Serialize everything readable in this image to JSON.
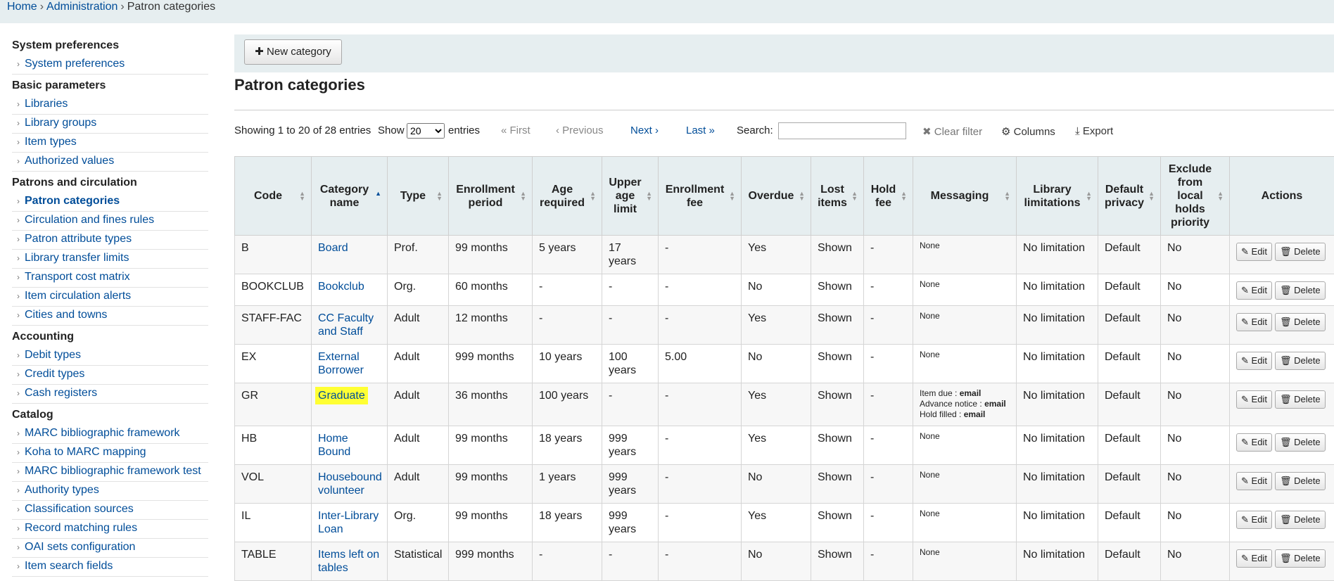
{
  "breadcrumb": {
    "home": "Home",
    "sep": "›",
    "admin": "Administration",
    "current": "Patron categories"
  },
  "sidebar": {
    "sections": [
      {
        "title": "System preferences",
        "items": [
          {
            "label": "System preferences"
          }
        ]
      },
      {
        "title": "Basic parameters",
        "items": [
          {
            "label": "Libraries"
          },
          {
            "label": "Library groups"
          },
          {
            "label": "Item types"
          },
          {
            "label": "Authorized values"
          }
        ]
      },
      {
        "title": "Patrons and circulation",
        "items": [
          {
            "label": "Patron categories",
            "active": true
          },
          {
            "label": "Circulation and fines rules"
          },
          {
            "label": "Patron attribute types"
          },
          {
            "label": "Library transfer limits"
          },
          {
            "label": "Transport cost matrix"
          },
          {
            "label": "Item circulation alerts"
          },
          {
            "label": "Cities and towns"
          }
        ]
      },
      {
        "title": "Accounting",
        "items": [
          {
            "label": "Debit types"
          },
          {
            "label": "Credit types"
          },
          {
            "label": "Cash registers"
          }
        ]
      },
      {
        "title": "Catalog",
        "items": [
          {
            "label": "MARC bibliographic framework"
          },
          {
            "label": "Koha to MARC mapping"
          },
          {
            "label": "MARC bibliographic framework test"
          },
          {
            "label": "Authority types"
          },
          {
            "label": "Classification sources"
          },
          {
            "label": "Record matching rules"
          },
          {
            "label": "OAI sets configuration"
          },
          {
            "label": "Item search fields"
          }
        ]
      }
    ]
  },
  "toolbar": {
    "new_category": "New category"
  },
  "page_title": "Patron categories",
  "controls": {
    "showing": "Showing 1 to 20 of 28 entries",
    "show": "Show",
    "page_length": "20",
    "entries": "entries",
    "first": "« First",
    "previous": "‹ Previous",
    "next": "Next ›",
    "last": "Last »",
    "search": "Search:",
    "search_value": "",
    "clear_filter": "Clear filter",
    "columns": "Columns",
    "export": "Export"
  },
  "table": {
    "headers": [
      "Code",
      "Category name",
      "Type",
      "Enrollment period",
      "Age required",
      "Upper age limit",
      "Enrollment fee",
      "Overdue",
      "Lost items",
      "Hold fee",
      "Messaging",
      "Library limitations",
      "Default privacy",
      "Exclude from local holds priority",
      "Actions"
    ],
    "edit": "Edit",
    "delete": "Delete",
    "rows": [
      {
        "code": "B",
        "name": "Board",
        "type": "Prof.",
        "enroll": "99 months",
        "age": "5 years",
        "upper": "17 years",
        "fee": "-",
        "overdue": "Yes",
        "lost": "Shown",
        "hold": "-",
        "messaging": [
          "None"
        ],
        "limit": "No limitation",
        "privacy": "Default",
        "exclude": "No"
      },
      {
        "code": "BOOKCLUB",
        "name": "Bookclub",
        "type": "Org.",
        "enroll": "60 months",
        "age": "-",
        "upper": "-",
        "fee": "-",
        "overdue": "No",
        "lost": "Shown",
        "hold": "-",
        "messaging": [
          "None"
        ],
        "limit": "No limitation",
        "privacy": "Default",
        "exclude": "No"
      },
      {
        "code": "STAFF-FAC",
        "name": "CC Faculty and Staff",
        "type": "Adult",
        "enroll": "12 months",
        "age": "-",
        "upper": "-",
        "fee": "-",
        "overdue": "Yes",
        "lost": "Shown",
        "hold": "-",
        "messaging": [
          "None"
        ],
        "limit": "No limitation",
        "privacy": "Default",
        "exclude": "No"
      },
      {
        "code": "EX",
        "name": "External Borrower",
        "type": "Adult",
        "enroll": "999 months",
        "age": "10 years",
        "upper": "100 years",
        "fee": "5.00",
        "overdue": "No",
        "lost": "Shown",
        "hold": "-",
        "messaging": [
          "None"
        ],
        "limit": "No limitation",
        "privacy": "Default",
        "exclude": "No"
      },
      {
        "code": "GR",
        "name": "Graduate",
        "highlight": true,
        "type": "Adult",
        "enroll": "36 months",
        "age": "100 years",
        "upper": "-",
        "fee": "-",
        "overdue": "Yes",
        "lost": "Shown",
        "hold": "-",
        "messaging": [
          {
            "k": "Item due : ",
            "v": "email"
          },
          {
            "k": "Advance notice : ",
            "v": "email"
          },
          {
            "k": "Hold filled : ",
            "v": "email"
          }
        ],
        "limit": "No limitation",
        "privacy": "Default",
        "exclude": "No"
      },
      {
        "code": "HB",
        "name": "Home Bound",
        "type": "Adult",
        "enroll": "99 months",
        "age": "18 years",
        "upper": "999 years",
        "fee": "-",
        "overdue": "Yes",
        "lost": "Shown",
        "hold": "-",
        "messaging": [
          "None"
        ],
        "limit": "No limitation",
        "privacy": "Default",
        "exclude": "No"
      },
      {
        "code": "VOL",
        "name": "Housebound volunteer",
        "type": "Adult",
        "enroll": "99 months",
        "age": "1 years",
        "upper": "999 years",
        "fee": "-",
        "overdue": "No",
        "lost": "Shown",
        "hold": "-",
        "messaging": [
          "None"
        ],
        "limit": "No limitation",
        "privacy": "Default",
        "exclude": "No"
      },
      {
        "code": "IL",
        "name": "Inter-Library Loan",
        "type": "Org.",
        "enroll": "99 months",
        "age": "18 years",
        "upper": "999 years",
        "fee": "-",
        "overdue": "Yes",
        "lost": "Shown",
        "hold": "-",
        "messaging": [
          "None"
        ],
        "limit": "No limitation",
        "privacy": "Default",
        "exclude": "No"
      },
      {
        "code": "TABLE",
        "name": "Items left on tables",
        "type": "Statistical",
        "enroll": "999 months",
        "age": "-",
        "upper": "-",
        "fee": "-",
        "overdue": "No",
        "lost": "Shown",
        "hold": "-",
        "messaging": [
          "None"
        ],
        "limit": "No limitation",
        "privacy": "Default",
        "exclude": "No"
      }
    ]
  }
}
